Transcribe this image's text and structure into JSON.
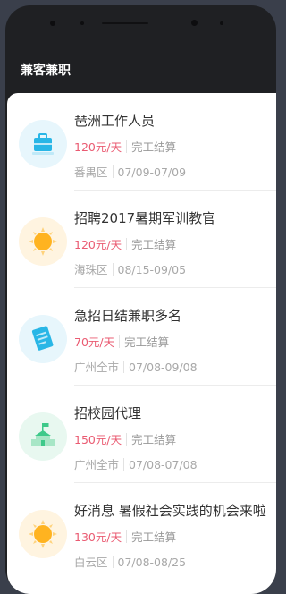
{
  "app": {
    "title": "兼客兼职"
  },
  "jobs": [
    {
      "title": "琶洲工作人员",
      "salary": "120元/天",
      "settlement": "完工结算",
      "district": "番禺区",
      "dates": "07/09-07/09",
      "icon": "briefcase-icon",
      "icon_bg": "#e7f6fc",
      "icon_color": "#29b6e6"
    },
    {
      "title": "招聘2017暑期军训教官",
      "salary": "120元/天",
      "settlement": "完工结算",
      "district": "海珠区",
      "dates": "08/15-09/05",
      "icon": "sun-icon",
      "icon_bg": "#fff4e0",
      "icon_color": "#ffb320"
    },
    {
      "title": "急招日结兼职多名",
      "salary": "70元/天",
      "settlement": "完工结算",
      "district": "广州全市",
      "dates": "07/08-09/08",
      "icon": "document-icon",
      "icon_bg": "#e7f6fc",
      "icon_color": "#29b6e6"
    },
    {
      "title": "招校园代理",
      "salary": "150元/天",
      "settlement": "完工结算",
      "district": "广州全市",
      "dates": "07/08-07/08",
      "icon": "school-icon",
      "icon_bg": "#e8f8f0",
      "icon_color": "#3ec98a"
    },
    {
      "title": "好消息 暑假社会实践的机会来啦",
      "salary": "130元/天",
      "settlement": "完工结算",
      "district": "白云区",
      "dates": "07/08-08/25",
      "icon": "sun-icon",
      "icon_bg": "#fff4e0",
      "icon_color": "#ffb320"
    }
  ]
}
